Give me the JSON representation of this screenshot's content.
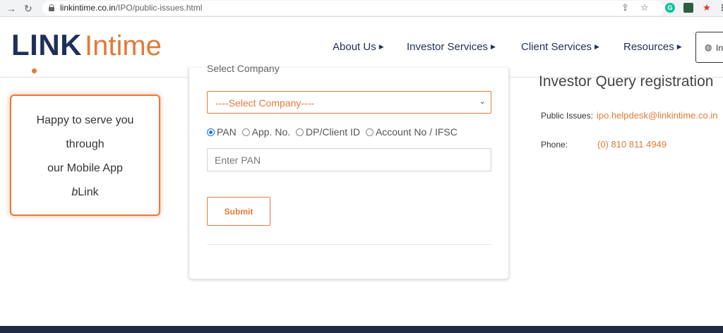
{
  "browser": {
    "url_host": "linkintime.co.in",
    "url_path": "/IPO/public-issues.html"
  },
  "colors": {
    "brand_navy": "#1f2f5b",
    "brand_orange": "#e07b39",
    "radio_selected": "#1a73e8",
    "footer": "#1f2a44"
  },
  "logo": {
    "part1": "LINK",
    "part2": "Intime"
  },
  "nav": {
    "items": [
      {
        "label": "About Us"
      },
      {
        "label": "Investor Services"
      },
      {
        "label": "Client Services"
      },
      {
        "label": "Resources"
      }
    ],
    "language_label": "In"
  },
  "app_card": {
    "line1": "Happy to serve you",
    "line2": "through",
    "line3": "our Mobile App",
    "line4_prefix": "b",
    "line4_suffix": "Link"
  },
  "form": {
    "cut_label": "Select Company",
    "company_select_value": "----Select Company----",
    "radios": [
      {
        "label": "PAN",
        "selected": true
      },
      {
        "label": "App. No.",
        "selected": false
      },
      {
        "label": "DP/Client ID",
        "selected": false
      },
      {
        "label": "Account No / IFSC",
        "selected": false
      }
    ],
    "pan_placeholder": "Enter PAN",
    "submit_label": "Submit"
  },
  "info": {
    "title": "Investor Query registration",
    "public_issues_label": "Public Issues:",
    "public_issues_email": "ipo.helpdesk@linkintime.co.in",
    "phone_label": "Phone:",
    "phone_value": "(0) 810 811 4949"
  }
}
